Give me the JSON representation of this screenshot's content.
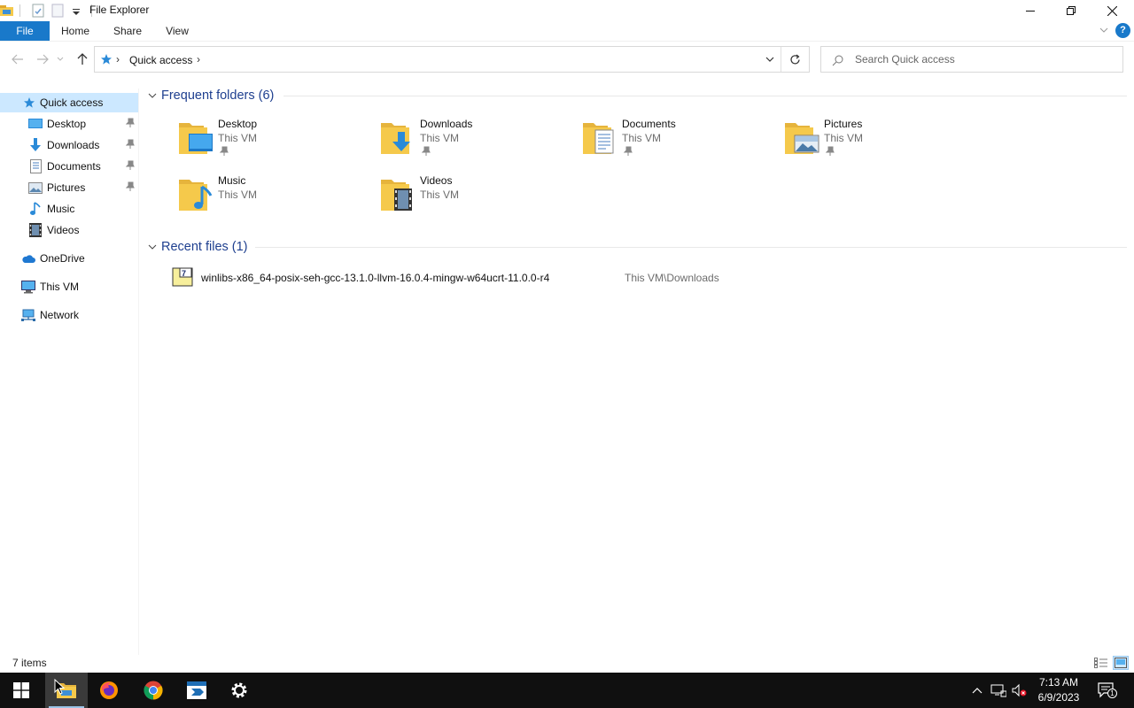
{
  "window": {
    "title": "File Explorer",
    "controls": {
      "minimize": "minimize-icon",
      "restore": "restore-icon",
      "close": "close-icon"
    }
  },
  "ribbon": {
    "tabs": [
      "File",
      "Home",
      "Share",
      "View"
    ],
    "help": "?"
  },
  "navigation": {
    "address_path": "Quick access",
    "search_placeholder": "Search Quick access"
  },
  "sidebar": {
    "items": [
      {
        "label": "Quick access",
        "icon": "star-icon",
        "selected": true
      },
      {
        "label": "Desktop",
        "icon": "desktop-icon",
        "pinned": true
      },
      {
        "label": "Downloads",
        "icon": "download-arrow-icon",
        "pinned": true
      },
      {
        "label": "Documents",
        "icon": "document-icon",
        "pinned": true
      },
      {
        "label": "Pictures",
        "icon": "picture-icon",
        "pinned": true
      },
      {
        "label": "Music",
        "icon": "music-note-icon"
      },
      {
        "label": "Videos",
        "icon": "film-icon"
      },
      {
        "label": "OneDrive",
        "icon": "cloud-icon"
      },
      {
        "label": "This VM",
        "icon": "computer-icon"
      },
      {
        "label": "Network",
        "icon": "network-icon"
      }
    ]
  },
  "content": {
    "frequent_header": "Frequent folders (6)",
    "folders": [
      {
        "name": "Desktop",
        "location": "This VM",
        "pinned": true,
        "icon": "desktop-folder-icon"
      },
      {
        "name": "Downloads",
        "location": "This VM",
        "pinned": true,
        "icon": "downloads-folder-icon"
      },
      {
        "name": "Documents",
        "location": "This VM",
        "pinned": true,
        "icon": "documents-folder-icon"
      },
      {
        "name": "Pictures",
        "location": "This VM",
        "pinned": true,
        "icon": "pictures-folder-icon"
      },
      {
        "name": "Music",
        "location": "This VM",
        "pinned": false,
        "icon": "music-folder-icon"
      },
      {
        "name": "Videos",
        "location": "This VM",
        "pinned": false,
        "icon": "videos-folder-icon"
      }
    ],
    "recent_header": "Recent files (1)",
    "recent_files": [
      {
        "name": "winlibs-x86_64-posix-seh-gcc-13.1.0-llvm-16.0.4-mingw-w64ucrt-11.0.0-r4",
        "path": "This VM\\Downloads",
        "icon": "7zip-archive-icon"
      }
    ]
  },
  "status": {
    "item_count": "7 items"
  },
  "taskbar": {
    "apps": [
      "start-icon",
      "file-explorer-icon",
      "firefox-icon",
      "chrome-icon",
      "remote-desktop-icon",
      "settings-gear-icon"
    ],
    "active_app": "file-explorer-icon",
    "time": "7:13 AM",
    "date": "6/9/2023",
    "notification_count": "1"
  },
  "colors": {
    "accent": "#1979ca",
    "selection": "#cce8ff",
    "group_header": "#1e3f8f",
    "taskbar": "#101010",
    "folder_yellow": "#f5c94b"
  }
}
